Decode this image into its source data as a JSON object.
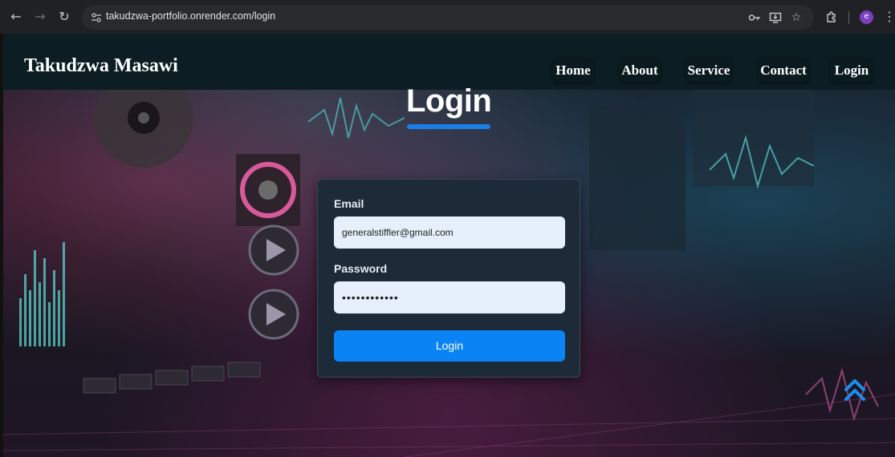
{
  "browser": {
    "url": "takudzwa-portfolio.onrender.com/login",
    "profile_initial": "e",
    "icons": [
      "back-arrow-icon",
      "forward-arrow-icon",
      "reload-icon",
      "site-info-icon",
      "password-key-icon",
      "install-app-icon",
      "bookmark-star-icon",
      "extensions-puzzle-icon",
      "more-menu-icon"
    ]
  },
  "header": {
    "brand": "Takudzwa Masawi",
    "nav": [
      {
        "label": "Home"
      },
      {
        "label": "About"
      },
      {
        "label": "Service"
      },
      {
        "label": "Contact"
      },
      {
        "label": "Login"
      }
    ]
  },
  "login": {
    "title": "Login",
    "email_label": "Email",
    "email_value": "generalstiffler@gmail.com",
    "password_label": "Password",
    "password_masked": "••••••••••••",
    "submit_label": "Login"
  },
  "colors": {
    "accent": "#0a84f5",
    "header_bg": "#0c1e24",
    "card_bg": "#1d2a37",
    "input_bg": "#e6f0fd"
  }
}
